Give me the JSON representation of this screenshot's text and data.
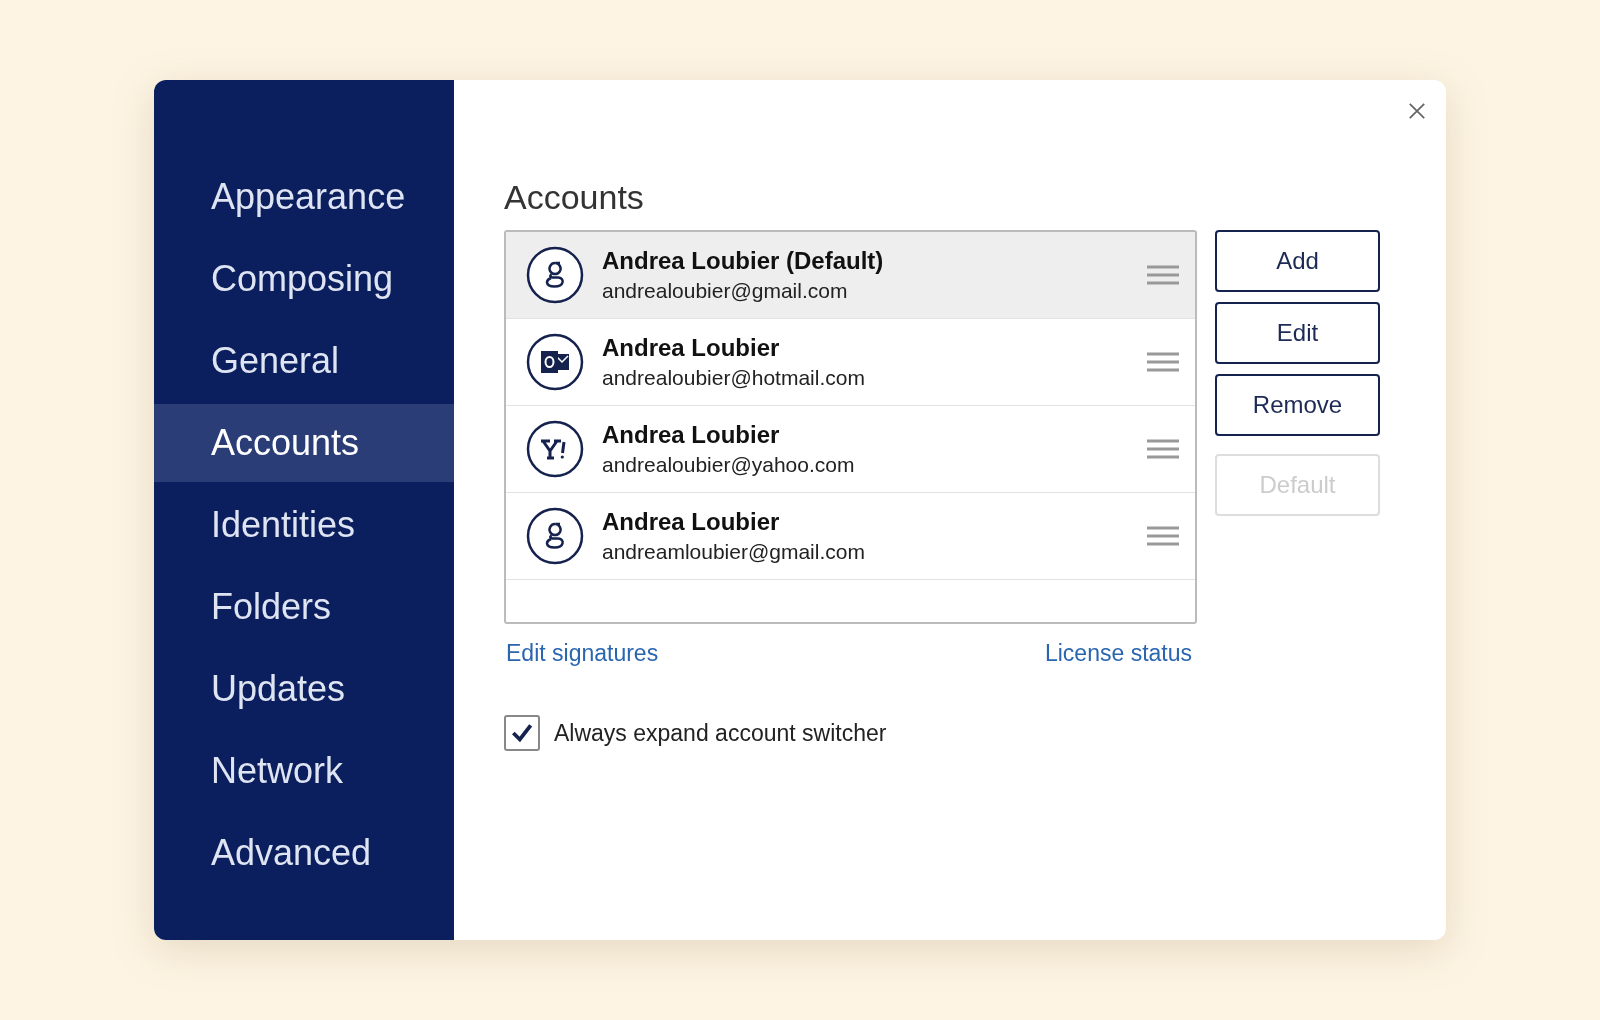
{
  "sidebar": {
    "items": [
      {
        "label": "Appearance",
        "selected": false
      },
      {
        "label": "Composing",
        "selected": false
      },
      {
        "label": "General",
        "selected": false
      },
      {
        "label": "Accounts",
        "selected": true
      },
      {
        "label": "Identities",
        "selected": false
      },
      {
        "label": "Folders",
        "selected": false
      },
      {
        "label": "Updates",
        "selected": false
      },
      {
        "label": "Network",
        "selected": false
      },
      {
        "label": "Advanced",
        "selected": false
      }
    ]
  },
  "heading": "Accounts",
  "accounts": [
    {
      "kind": "google",
      "name": "Andrea Loubier (Default)",
      "email": "andrealoubier@gmail.com",
      "selected": true
    },
    {
      "kind": "outlook",
      "name": "Andrea Loubier",
      "email": "andrealoubier@hotmail.com",
      "selected": false
    },
    {
      "kind": "yahoo",
      "name": "Andrea Loubier",
      "email": "andrealoubier@yahoo.com",
      "selected": false
    },
    {
      "kind": "google",
      "name": "Andrea Loubier",
      "email": "andreamloubier@gmail.com",
      "selected": false
    }
  ],
  "buttons": [
    {
      "label": "Add",
      "disabled": false
    },
    {
      "label": "Edit",
      "disabled": false
    },
    {
      "label": "Remove",
      "disabled": false
    },
    {
      "label": "Default",
      "disabled": true
    }
  ],
  "links": [
    "Edit signatures",
    "License status"
  ],
  "checkbox": {
    "label": "Always expand account switcher",
    "checked": true
  }
}
